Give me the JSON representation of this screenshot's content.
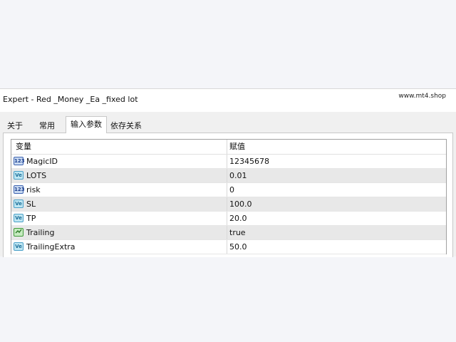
{
  "window": {
    "title": "Expert - Red _Money _Ea _fixed lot",
    "watermark": "www.mt4.shop"
  },
  "tabs": [
    {
      "label": "关于",
      "active": false
    },
    {
      "label": "常用",
      "active": false
    },
    {
      "label": "输入参数",
      "active": true
    },
    {
      "label": "依存关系",
      "active": false
    }
  ],
  "grid": {
    "columns": {
      "variable": "变量",
      "value": "赋值"
    },
    "rows": [
      {
        "icon": "int-icon",
        "icon_text": "123",
        "name": "MagicID",
        "value": "12345678"
      },
      {
        "icon": "double-icon",
        "icon_text": "Ve",
        "name": "LOTS",
        "value": "0.01"
      },
      {
        "icon": "int-icon",
        "icon_text": "123",
        "name": "risk",
        "value": "0"
      },
      {
        "icon": "double-icon",
        "icon_text": "Ve",
        "name": "SL",
        "value": "100.0"
      },
      {
        "icon": "double-icon",
        "icon_text": "Ve",
        "name": "TP",
        "value": "20.0"
      },
      {
        "icon": "bool-icon",
        "icon_text": "",
        "name": "Trailing",
        "value": "true"
      },
      {
        "icon": "double-icon",
        "icon_text": "Ve",
        "name": "TrailingExtra",
        "value": "50.0"
      }
    ]
  },
  "colors": {
    "page_background": "#f4f5f9",
    "row_alt": "#e8e8e8",
    "icon_blue": "#4a7fb5"
  }
}
